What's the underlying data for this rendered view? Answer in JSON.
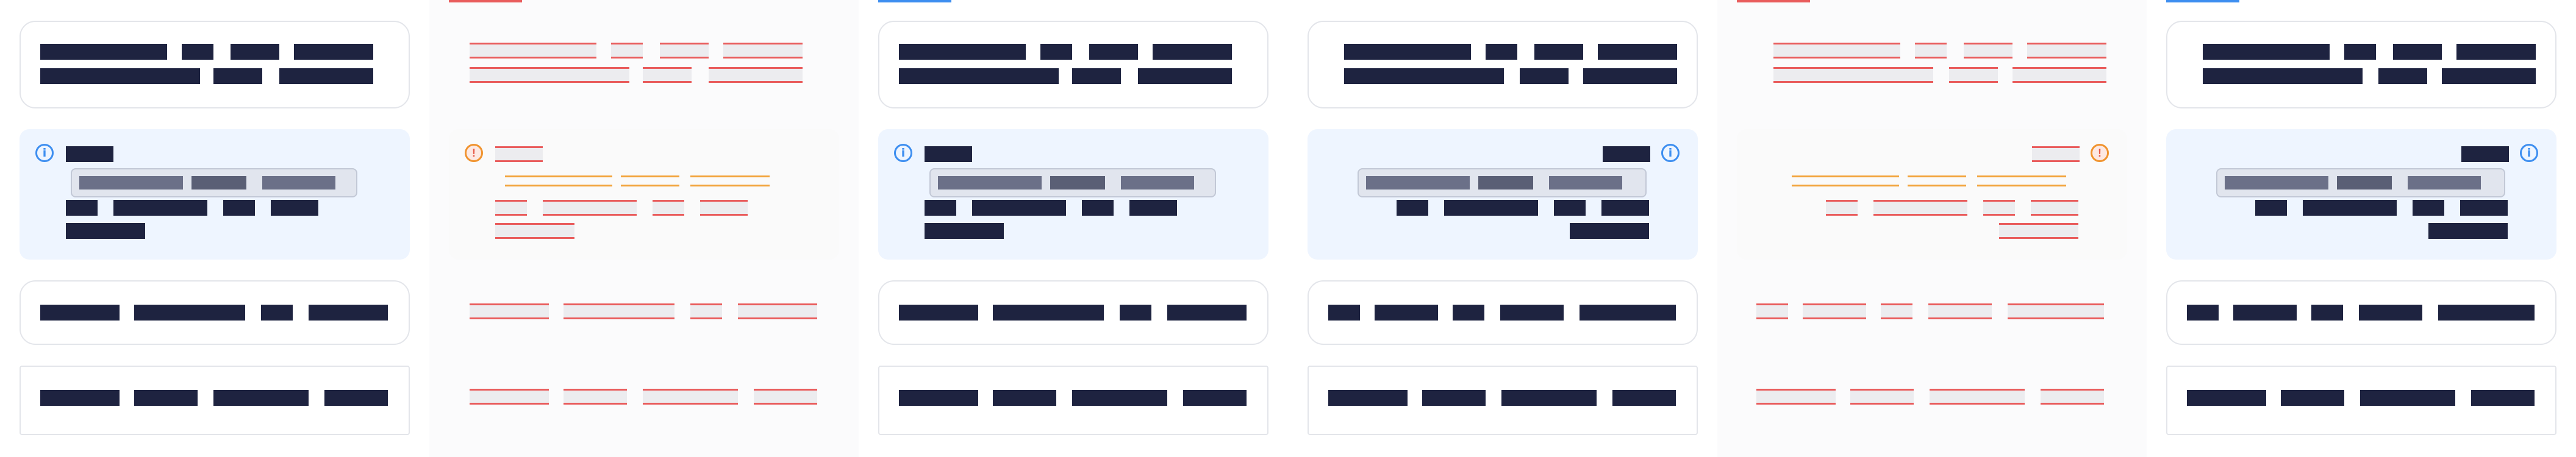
{
  "panels": [
    {
      "id": "panel-1",
      "variant": "ltr-default"
    },
    {
      "id": "panel-2",
      "variant": "ltr-diff-ghost"
    },
    {
      "id": "panel-3",
      "variant": "ltr-alt"
    },
    {
      "id": "panel-4",
      "variant": "rtl-default"
    },
    {
      "id": "panel-5",
      "variant": "rtl-diff-ghost"
    },
    {
      "id": "panel-6",
      "variant": "rtl-alt"
    }
  ],
  "icons": {
    "info": "info-circle-icon",
    "warning": "warning-circle-icon",
    "info_glyph": "i",
    "warning_glyph": "!"
  },
  "colors": {
    "text_dark": "#1e2340",
    "accent_blue": "#3d8ef0",
    "callout_info_bg": "#eef5ff",
    "diff_red": "#e95c5c",
    "diff_orange": "#f2a33a",
    "slider_bg": "#e1e5ee"
  }
}
